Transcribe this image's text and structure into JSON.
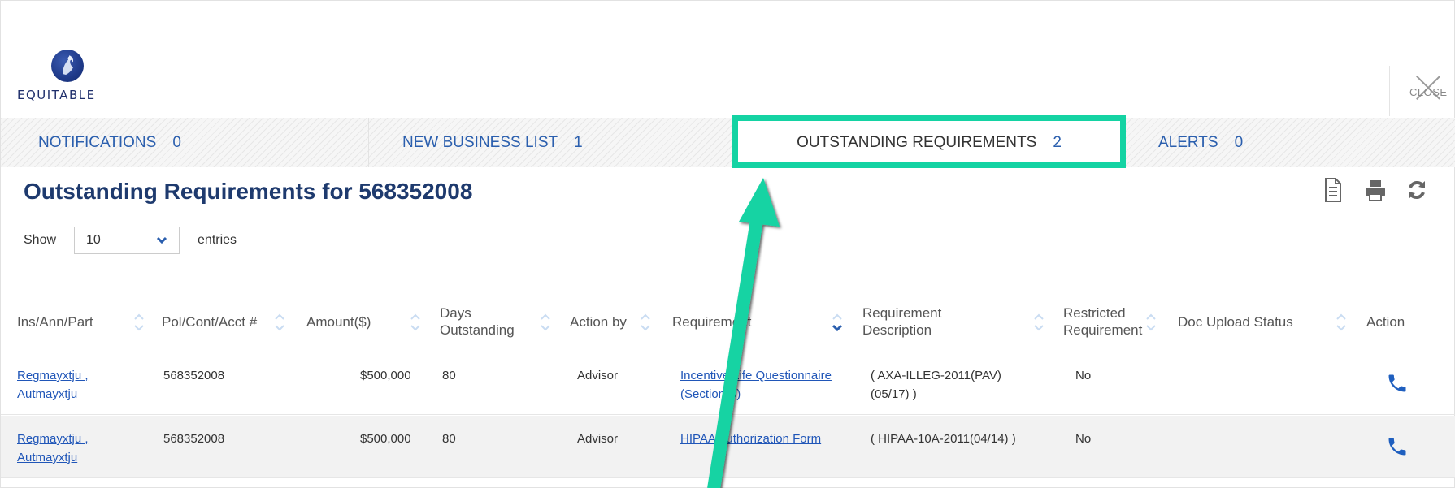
{
  "header": {
    "logo_text": "EQUITABLE",
    "close_label": "CLOSE"
  },
  "tabs": [
    {
      "label": "NOTIFICATIONS",
      "count": "0"
    },
    {
      "label": "NEW BUSINESS LIST",
      "count": "1"
    },
    {
      "label": "OUTSTANDING REQUIREMENTS",
      "count": "2"
    },
    {
      "label": "ALERTS",
      "count": "0"
    }
  ],
  "page": {
    "title": "Outstanding Requirements for 568352008",
    "show_label": "Show",
    "entries_value": "10",
    "entries_label": "entries"
  },
  "table": {
    "headers": [
      "Ins/Ann/Part",
      "Pol/Cont/Acct #",
      "Amount($)",
      "Days Outstanding",
      "Action by",
      "Requirement",
      "Requirement Description",
      "Restricted Requirement",
      "Doc Upload Status",
      "Action"
    ],
    "rows": [
      {
        "name_line1": "Regmayxtju ,",
        "name_line2": "Autmayxtju",
        "policy": "568352008",
        "amount": "$500,000",
        "days": "80",
        "action_by": "Advisor",
        "req_line1": "Incentive Life Questionnaire",
        "req_line2": "(Section B)",
        "desc_line1": "( AXA-ILLEG-2011(PAV)",
        "desc_line2": "(05/17) )",
        "restricted": "No"
      },
      {
        "name_line1": "Regmayxtju ,",
        "name_line2": "Autmayxtju",
        "policy": "568352008",
        "amount": "$500,000",
        "days": "80",
        "action_by": "Advisor",
        "req_line1": "HIPAA Authorization Form",
        "req_line2": "",
        "desc_line1": "( HIPAA-10A-2011(04/14) )",
        "desc_line2": "",
        "restricted": "No"
      }
    ]
  },
  "colors": {
    "highlight": "#14d3a3",
    "link": "#2056b8",
    "title": "#1e3a6e",
    "phone": "#1f5fbf"
  },
  "icons": [
    "close-icon",
    "document-icon",
    "print-icon",
    "refresh-icon",
    "chevron-down-icon",
    "sort-icon",
    "phone-icon",
    "arrow-annotation"
  ]
}
